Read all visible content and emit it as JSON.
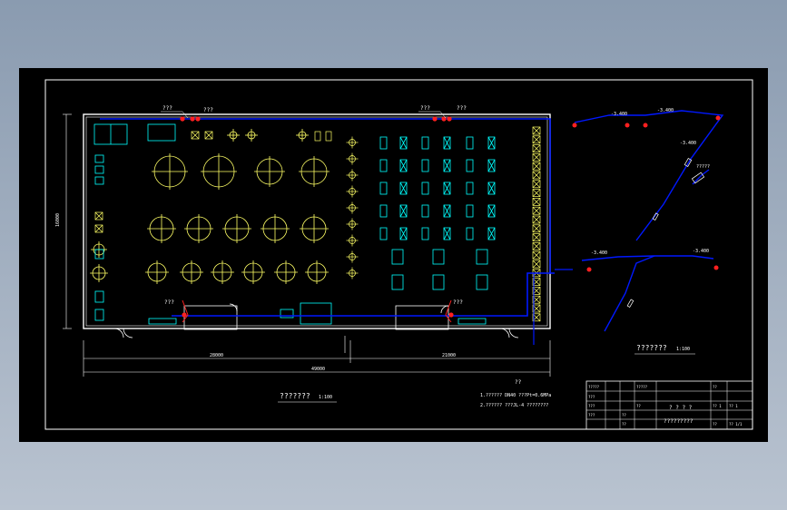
{
  "drawing": {
    "valve_labels": [
      "???",
      "???",
      "???",
      "???",
      "???",
      "???"
    ],
    "dim_left_height": "16000",
    "dim_bottom_left": "28000",
    "dim_bottom_right": "21000",
    "dim_bottom_total": "49000",
    "plan_title": "???????",
    "plan_scale": "1:100",
    "iso_title": "???????",
    "iso_scale": "1:100",
    "iso_labels": [
      "-3.400",
      "-3.400",
      "-3.400",
      "-3.400",
      "?????",
      "-3.400"
    ],
    "notes_heading": "??",
    "notes_line1": "1.?????? DN40 ???Pt=0.6MPa",
    "notes_line2": "2.?????? ???JL-4 ????????",
    "title_block_project": "? ? ? ?",
    "title_block_drawing": "?????????",
    "title_block_cells": [
      "?????",
      "???",
      "???",
      "???",
      "?????",
      "??",
      "??",
      "??",
      "??",
      "?? 1",
      "??",
      "?? 1",
      "?? 1/1"
    ]
  },
  "colors": {
    "background": "#000000",
    "frame": "#ffffff",
    "equipment": "#ffff66",
    "outline": "#00ffff",
    "pipe": "#0018ff",
    "valve": "#ff2020"
  }
}
